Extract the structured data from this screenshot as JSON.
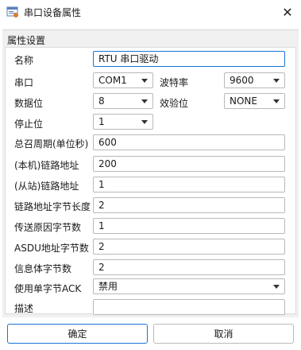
{
  "window": {
    "title": "串口设备属性"
  },
  "group": {
    "title": "属性设置"
  },
  "fields": {
    "name": {
      "label": "名称",
      "value": "RTU 串口驱动"
    },
    "port": {
      "label": "串口",
      "value": "COM1"
    },
    "baud": {
      "label": "波特率",
      "value": "9600"
    },
    "databits": {
      "label": "数据位",
      "value": "8"
    },
    "parity": {
      "label": "效验位",
      "value": "NONE"
    },
    "stopbits": {
      "label": "停止位",
      "value": "1"
    },
    "gi_period": {
      "label": "总召周期(单位秒)",
      "value": "600"
    },
    "local_addr": {
      "label": "(本机)链路地址",
      "value": "200"
    },
    "remote_addr": {
      "label": "(从站)链路地址",
      "value": "1"
    },
    "link_addr_len": {
      "label": "链路地址字节长度",
      "value": "2"
    },
    "cot_len": {
      "label": "传送原因字节数",
      "value": "1"
    },
    "asdu_addr_len": {
      "label": "ASDU地址字节数",
      "value": "2"
    },
    "ioa_len": {
      "label": "信息体字节数",
      "value": "2"
    },
    "single_ack": {
      "label": "使用单字节ACK",
      "value": "禁用"
    },
    "description": {
      "label": "描述",
      "value": ""
    }
  },
  "buttons": {
    "ok": "确定",
    "cancel": "取消"
  },
  "icons": {
    "app": "window-properties-icon",
    "close": "close-icon",
    "dropdown": "chevron-down-icon"
  },
  "colors": {
    "accent": "#1a73d9",
    "panel": "#f0f0f0"
  }
}
